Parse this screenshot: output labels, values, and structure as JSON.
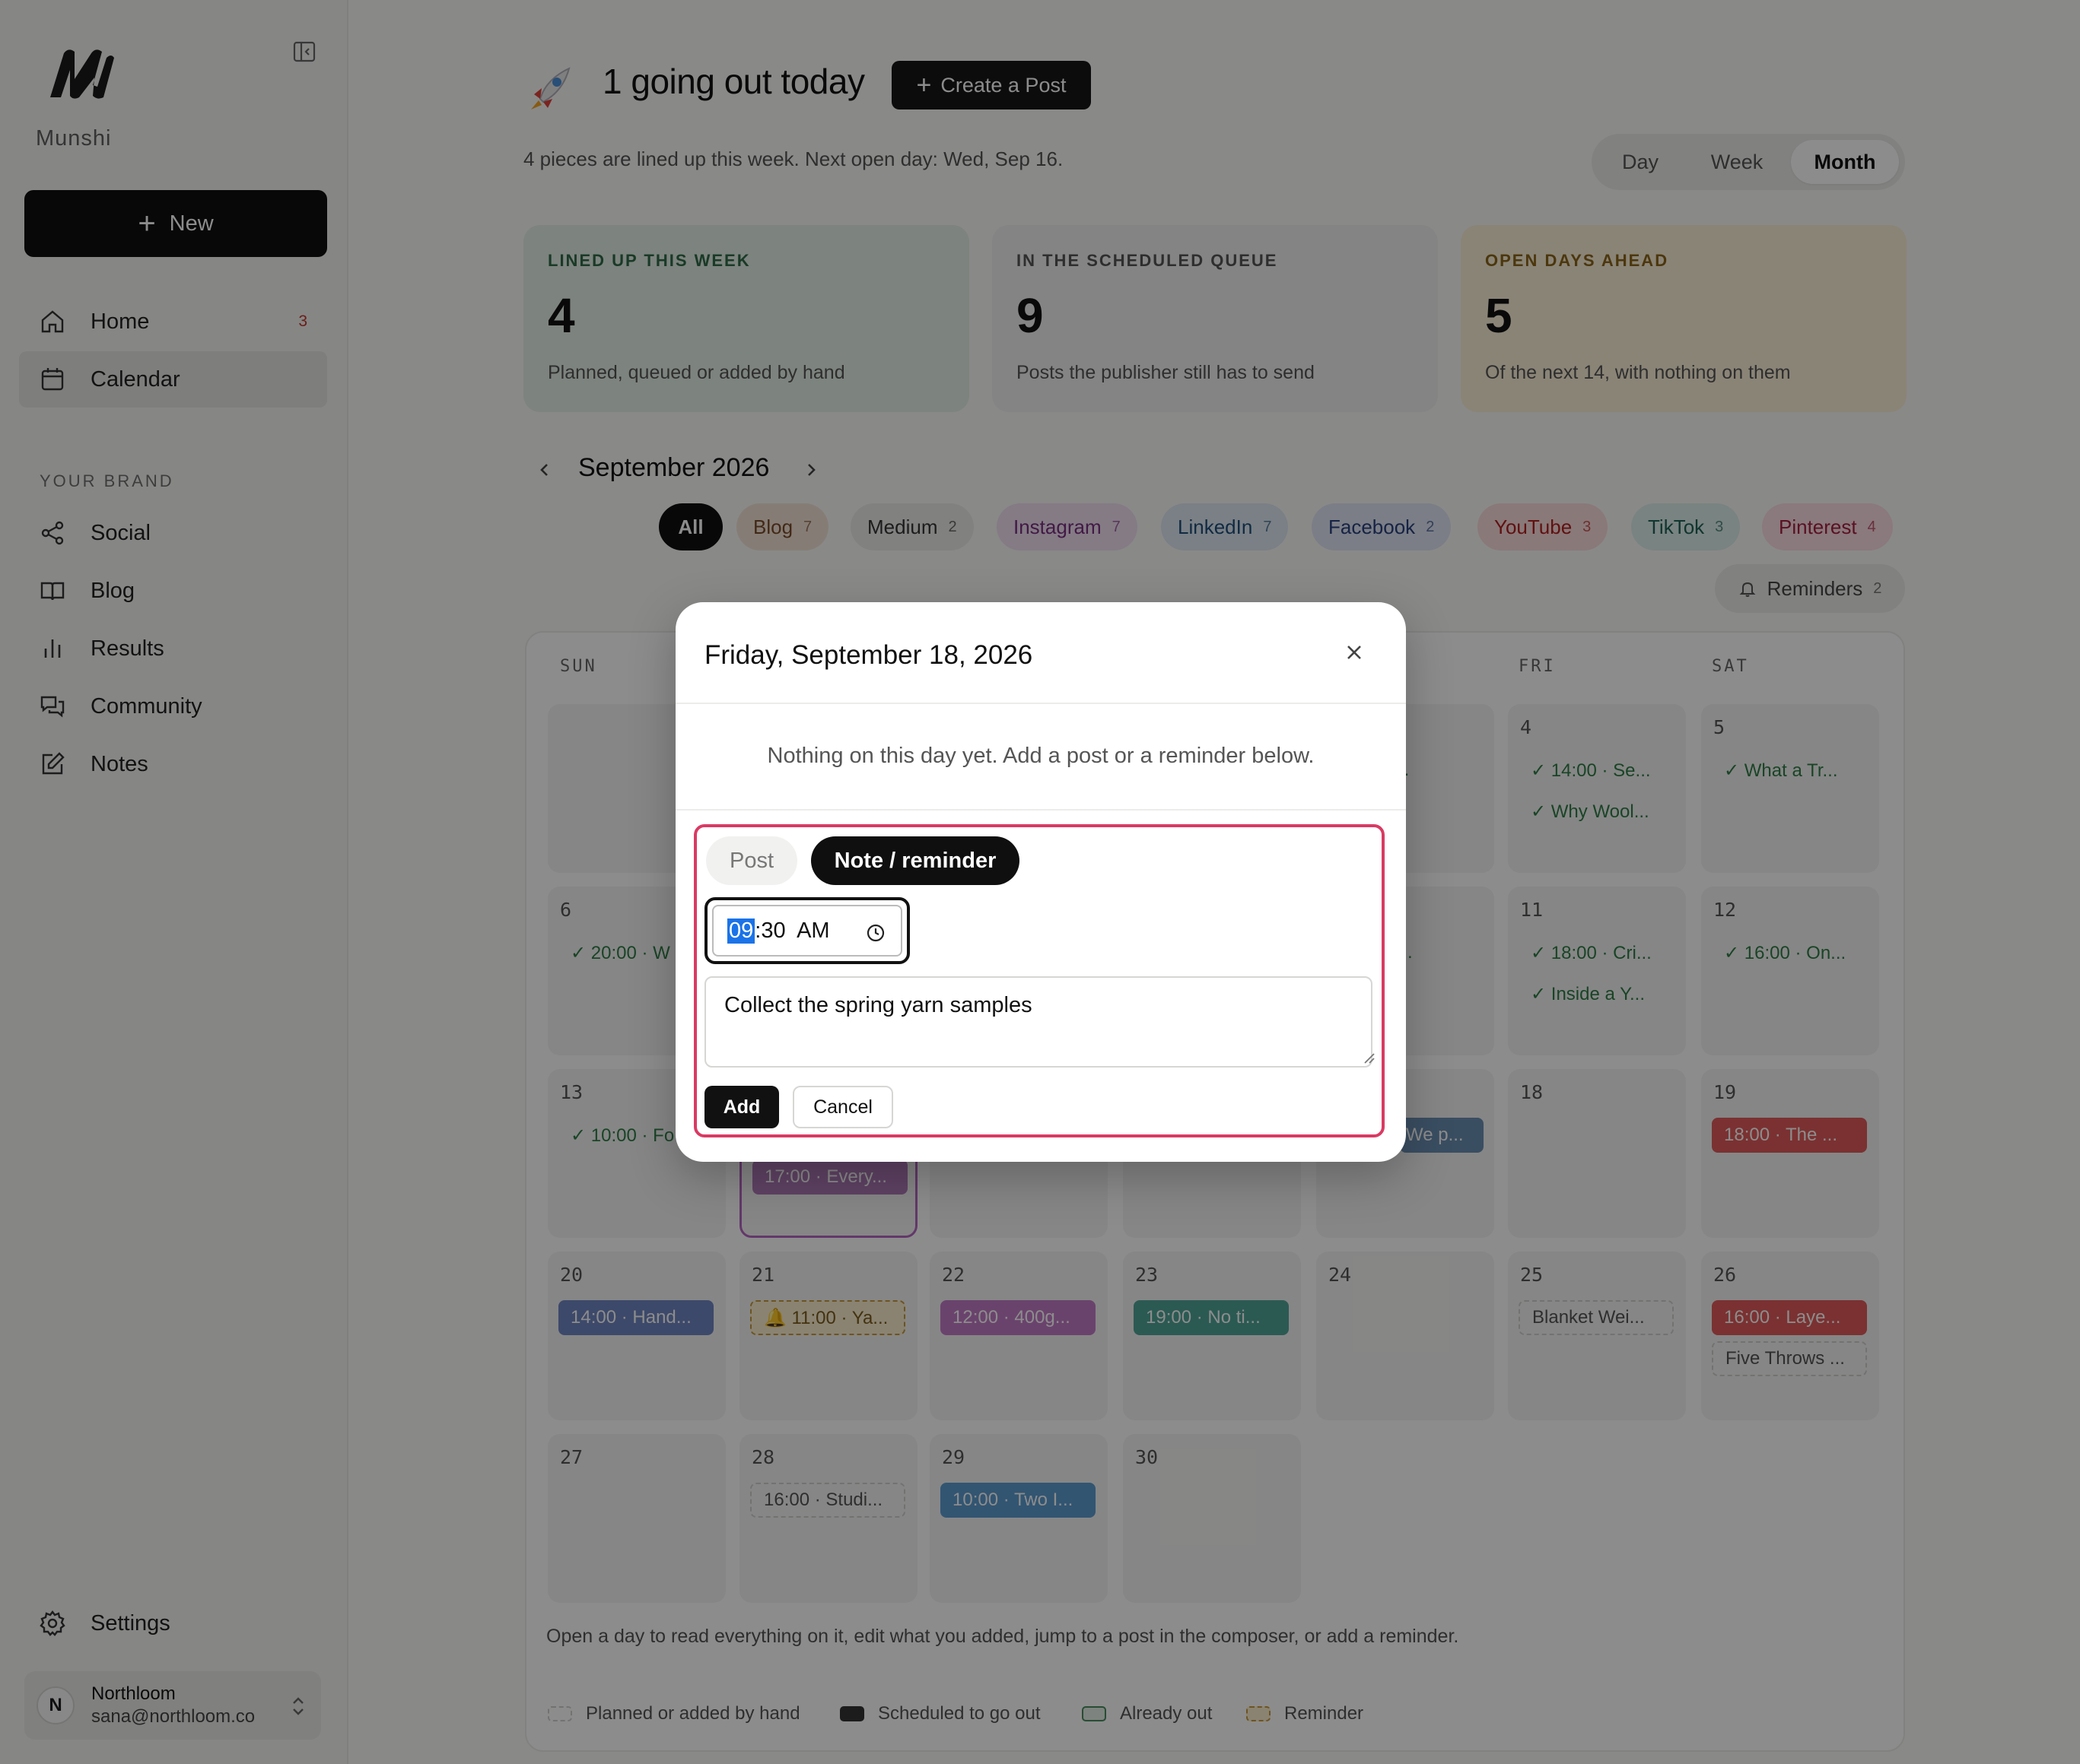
{
  "sidebar": {
    "brand_name": "Munshi",
    "new_label": "New",
    "nav": [
      {
        "label": "Home",
        "badge": "3",
        "icon": "home-icon"
      },
      {
        "label": "Calendar",
        "icon": "calendar-icon",
        "active": true
      }
    ],
    "section_label": "YOUR BRAND",
    "brand_nav": [
      {
        "label": "Social",
        "icon": "share-icon"
      },
      {
        "label": "Blog",
        "icon": "book-icon"
      },
      {
        "label": "Results",
        "icon": "bar-chart-icon"
      },
      {
        "label": "Community",
        "icon": "chat-icon"
      },
      {
        "label": "Notes",
        "icon": "edit-icon"
      }
    ],
    "settings_label": "Settings",
    "account": {
      "initial": "N",
      "name": "Northloom",
      "email": "sana@northloom.co"
    }
  },
  "header": {
    "title": "1 going out today",
    "create_label": "Create a Post",
    "subtitle": "4 pieces are lined up this week. Next open day: Wed, Sep 16.",
    "views": [
      "Day",
      "Week",
      "Month"
    ],
    "active_view": "Month"
  },
  "stats": [
    {
      "label": "LINED UP THIS WEEK",
      "value": "4",
      "desc": "Planned, queued or added by hand",
      "color": "#e3efe6",
      "label_color": "#2e6b47"
    },
    {
      "label": "IN THE SCHEDULED QUEUE",
      "value": "9",
      "desc": "Posts the publisher still has to send",
      "color": "#f1f1f0",
      "label_color": "#555555"
    },
    {
      "label": "OPEN DAYS AHEAD",
      "value": "5",
      "desc": "Of the next 14, with nothing on them",
      "color": "#fbf0d9",
      "label_color": "#8a6418"
    }
  ],
  "calendar": {
    "month_title": "September 2026",
    "filters": [
      {
        "label": "All",
        "count": "",
        "bg": "#0f0f0f",
        "fg": "#ffffff"
      },
      {
        "label": "Blog",
        "count": "7",
        "bg": "#f3e3d6",
        "fg": "#7a4a2a"
      },
      {
        "label": "Medium",
        "count": "2",
        "bg": "#ececea",
        "fg": "#333333"
      },
      {
        "label": "Instagram",
        "count": "7",
        "bg": "#f1e0f2",
        "fg": "#7b2f80"
      },
      {
        "label": "LinkedIn",
        "count": "7",
        "bg": "#dfe9f3",
        "fg": "#1f4e7a"
      },
      {
        "label": "Facebook",
        "count": "2",
        "bg": "#e1e6f5",
        "fg": "#28407e"
      },
      {
        "label": "YouTube",
        "count": "3",
        "bg": "#fbdcdc",
        "fg": "#b02020"
      },
      {
        "label": "TikTok",
        "count": "3",
        "bg": "#dcefeb",
        "fg": "#1f6157"
      },
      {
        "label": "Pinterest",
        "count": "4",
        "bg": "#fbdde3",
        "fg": "#a52040"
      }
    ],
    "reminders_label": "Reminders",
    "reminders_count": "2",
    "weekdays": [
      "SUN",
      "MON",
      "TUE",
      "WED",
      "THU",
      "FRI",
      "SAT"
    ],
    "footer_text": "Open a day to read everything on it, edit what you added, jump to a post in the composer, or add a reminder.",
    "legend": [
      "Planned or added by hand",
      "Scheduled to go out",
      "Already out",
      "Reminder"
    ],
    "days": [
      {
        "num": "4",
        "chips": [
          "✓ 14:00 · Se...",
          "✓ Why Wool..."
        ]
      },
      {
        "num": "5",
        "chips": [
          "✓ What a Tr..."
        ]
      },
      {
        "num": "6",
        "chips": [
          "✓ 20:00 · W"
        ]
      },
      {
        "num": "11",
        "chips": [
          "✓ 18:00 · Cri...",
          "✓ Inside a Y..."
        ]
      },
      {
        "num": "12",
        "chips": [
          "✓ 16:00 · On..."
        ]
      },
      {
        "num": "13",
        "chips": [
          "✓ 10:00 · Fo"
        ]
      },
      {
        "num": "18",
        "chips": []
      },
      {
        "num": "19",
        "chips": [
          "18:00 · The ..."
        ]
      },
      {
        "num": "20",
        "chips": [
          "14:00 · Hand..."
        ]
      },
      {
        "num": "21",
        "chips": [
          "🔔 11:00 · Ya..."
        ]
      },
      {
        "num": "22",
        "chips": [
          "12:00 · 400g..."
        ]
      },
      {
        "num": "23",
        "chips": [
          "19:00 · No ti..."
        ]
      },
      {
        "num": "24",
        "chips": []
      },
      {
        "num": "25",
        "chips": [
          "Blanket Wei..."
        ]
      },
      {
        "num": "26",
        "chips": [
          "16:00 · Laye...",
          "Five Throws ..."
        ]
      },
      {
        "num": "27",
        "chips": []
      },
      {
        "num": "28",
        "chips": [
          "16:00 · Studi..."
        ]
      },
      {
        "num": "29",
        "chips": [
          "10:00 · Two I..."
        ]
      },
      {
        "num": "30",
        "chips": []
      }
    ],
    "partial": {
      "thu_row1": "0 · Th...",
      "thu_row2": "0 · Ou...",
      "thu_row3": "We p...",
      "mon_row3": "17:00 · Every..."
    }
  },
  "modal": {
    "title": "Friday, September 18, 2026",
    "empty_text": "Nothing on this day yet. Add a post or a reminder below.",
    "tab_post": "Post",
    "tab_note": "Note / reminder",
    "time_hh": "09",
    "time_rest": ":30  AM",
    "note_value": "Collect the spring yarn samples",
    "add_label": "Add",
    "cancel_label": "Cancel"
  }
}
